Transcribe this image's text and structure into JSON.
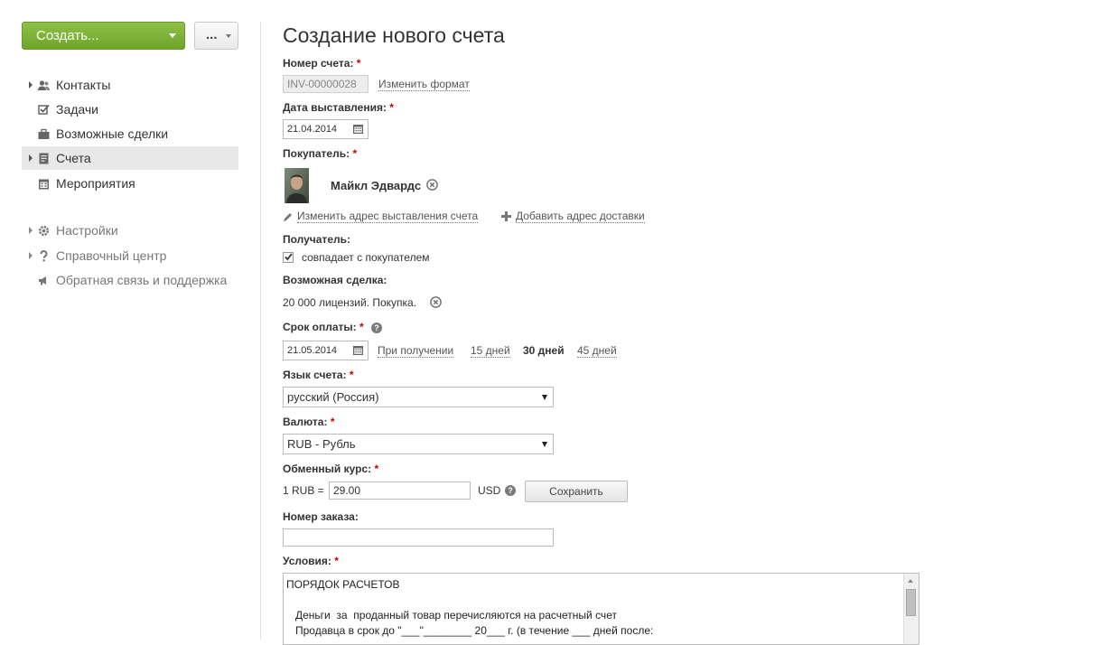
{
  "sidebar": {
    "create_label": "Создать...",
    "more_label": "...",
    "items": [
      {
        "label": "Контакты"
      },
      {
        "label": "Задачи"
      },
      {
        "label": "Возможные сделки"
      },
      {
        "label": "Счета"
      },
      {
        "label": "Мероприятия"
      },
      {
        "label": "Настройки"
      },
      {
        "label": "Справочный центр"
      },
      {
        "label": "Обратная связь и поддержка"
      }
    ]
  },
  "main": {
    "title": "Создание нового счета",
    "required_mark": "*",
    "invoice_number": {
      "label": "Номер счета:",
      "value": "INV-00000028",
      "change_format": "Изменить формат"
    },
    "issue_date": {
      "label": "Дата выставления:",
      "value": "21.04.2014"
    },
    "buyer": {
      "label": "Покупатель:",
      "name": "Майкл Эдвардс",
      "change_billing_address": "Изменить адрес выставления счета",
      "add_delivery_address": "Добавить адрес доставки"
    },
    "recipient": {
      "label": "Получатель:",
      "same_as_buyer": "совпадает с покупателем",
      "checked": true
    },
    "deal": {
      "label": "Возможная сделка:",
      "value": "20 000 лицензий. Покупка."
    },
    "due_date": {
      "label": "Срок оплаты:",
      "value": "21.05.2014",
      "help": "?",
      "options": [
        "При получении",
        "15 дней",
        "30 дней",
        "45 дней"
      ],
      "selected": "30 дней"
    },
    "language": {
      "label": "Язык счета:",
      "value": "русский (Россия)"
    },
    "currency": {
      "label": "Валюта:",
      "value": "RUB - Рубль"
    },
    "exchange_rate": {
      "label": "Обменный курс:",
      "prefix": "1 RUB =",
      "value": "29.00",
      "suffix": "USD",
      "help": "?",
      "save_label": "Сохранить"
    },
    "order_number": {
      "label": "Номер заказа:",
      "value": ""
    },
    "terms": {
      "label": "Условия:",
      "lines": [
        "ПОРЯДОК РАСЧЕТОВ",
        "",
        "   Деньги  за  проданный товар перечисляются на расчетный счет",
        "   Продавца в срок до \"___\"________ 20___ г. (в течение ___ дней после:"
      ]
    }
  }
}
